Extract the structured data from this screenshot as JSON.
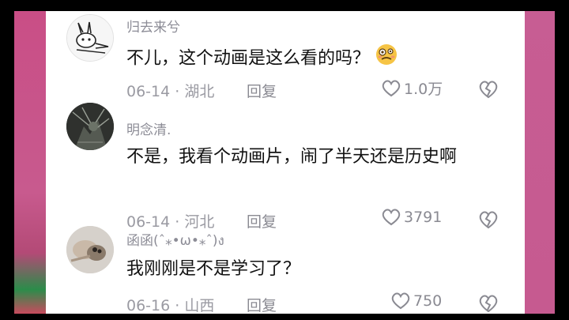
{
  "comments": [
    {
      "username": "归去来兮",
      "text": "不儿，这个动画是这么看的吗？",
      "emoji": "woozy-face",
      "date": "06-14",
      "location": "湖北",
      "reply_label": "回复",
      "likes": "1.0万"
    },
    {
      "username": "明念清.",
      "text": "不是，我看个动画片，闹了半天还是历史啊",
      "date": "06-14",
      "location": "河北",
      "reply_label": "回复",
      "likes": "3791"
    },
    {
      "username": "函函(ˆ⁎•ω•⁎ˆ)ง",
      "text": "我刚刚是不是学习了？",
      "date": "06-16",
      "location": "山西",
      "reply_label": "回复",
      "likes": "750"
    }
  ],
  "meta_separator": " · ",
  "colors": {
    "background_left": "#c94e86",
    "background_right": "#c65a90",
    "username": "#8c8c96",
    "text": "#111111",
    "meta": "#9a9aa2"
  }
}
